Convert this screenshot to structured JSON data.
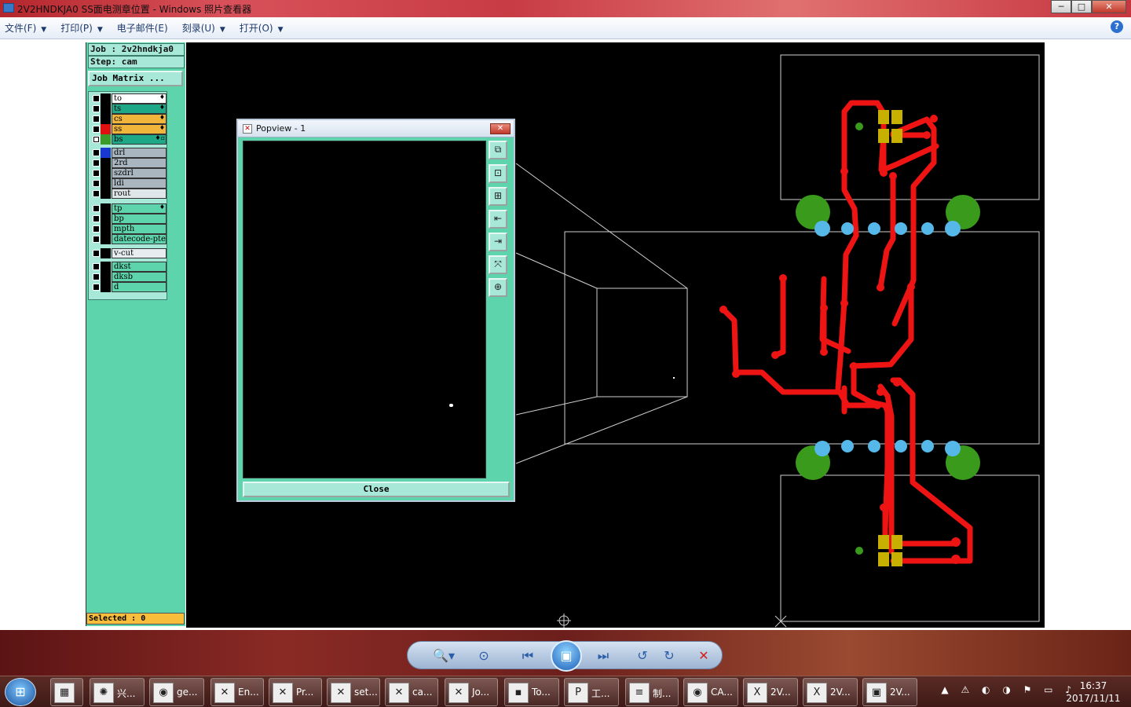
{
  "window": {
    "title": "2V2HNDKJA0 SS面电测章位置 - Windows 照片查看器",
    "minimize": "─",
    "maximize": "□",
    "close": "✕"
  },
  "menu": [
    {
      "label": "文件(F)",
      "arrow": "▼"
    },
    {
      "label": "打印(P)",
      "arrow": "▼"
    },
    {
      "label": "电子邮件(E)",
      "arrow": ""
    },
    {
      "label": "刻录(U)",
      "arrow": "▼"
    },
    {
      "label": "打开(O)",
      "arrow": "▼"
    }
  ],
  "help": "?",
  "genesis": {
    "job": "Job : 2v2hndkja0",
    "step": "Step: cam",
    "matrix_button": "Job Matrix ...",
    "selected": "Selected : 0",
    "layers": [
      {
        "name": "to",
        "checked": false,
        "swatch": "#000000",
        "bg": "#ffffff",
        "mark": "♦"
      },
      {
        "name": "ts",
        "checked": false,
        "swatch": "#000000",
        "bg": "#1fa888",
        "mark": "♦"
      },
      {
        "name": "cs",
        "checked": false,
        "swatch": "#000000",
        "bg": "#f2b53b",
        "mark": "♦"
      },
      {
        "name": "ss",
        "checked": false,
        "swatch": "#e01010",
        "bg": "#f2b53b",
        "mark": "♦"
      },
      {
        "name": "bs",
        "checked": true,
        "swatch": "#3a9a2a",
        "bg": "#1fa888",
        "mark": "♦▫"
      },
      {
        "name": "drl",
        "checked": false,
        "swatch": "#1838d0",
        "bg": "#a9b6bf",
        "mark": ""
      },
      {
        "name": "2rd",
        "checked": false,
        "swatch": "#000000",
        "bg": "#a9b6bf",
        "mark": ""
      },
      {
        "name": "szdrl",
        "checked": false,
        "swatch": "#000000",
        "bg": "#a9b6bf",
        "mark": ""
      },
      {
        "name": "ldi",
        "checked": false,
        "swatch": "#000000",
        "bg": "#a9b6bf",
        "mark": ""
      },
      {
        "name": "rout",
        "checked": false,
        "swatch": "#000000",
        "bg": "#dfe6ea",
        "mark": ""
      },
      {
        "name": "tp",
        "checked": false,
        "swatch": "#000000",
        "bg": "#5ed4ad",
        "mark": "♦"
      },
      {
        "name": "bp",
        "checked": false,
        "swatch": "#000000",
        "bg": "#5ed4ad",
        "mark": ""
      },
      {
        "name": "mpth",
        "checked": false,
        "swatch": "#000000",
        "bg": "#5ed4ad",
        "mark": ""
      },
      {
        "name": "datecode-pte",
        "checked": false,
        "swatch": "#000000",
        "bg": "#5ed4ad",
        "mark": ""
      },
      {
        "name": "v-cut",
        "checked": false,
        "swatch": "#000000",
        "bg": "#e6ecef",
        "mark": ""
      },
      {
        "name": "dkst",
        "checked": false,
        "swatch": "#000000",
        "bg": "#5ed4ad",
        "mark": ""
      },
      {
        "name": "dksb",
        "checked": false,
        "swatch": "#000000",
        "bg": "#5ed4ad",
        "mark": ""
      },
      {
        "name": "d",
        "checked": false,
        "swatch": "#000000",
        "bg": "#5ed4ad",
        "mark": ""
      }
    ]
  },
  "popup": {
    "title": "Popview - 1",
    "close_x": "✕",
    "close_button": "Close",
    "tools": [
      "⧉",
      "⊡",
      "⊞",
      "⇤",
      "⇥",
      "⤧",
      "⊕"
    ]
  },
  "player": {
    "zoom": "🔍▾",
    "fit": "⊙",
    "prev": "⏮",
    "slideshow": "▣",
    "next": "⏭",
    "rotate_ccw": "↺",
    "rotate_cw": "↻",
    "delete": "✕"
  },
  "taskbar": {
    "start": "⊞",
    "buttons": [
      {
        "icon": "▦",
        "label": ""
      },
      {
        "icon": "✺",
        "label": "兴..."
      },
      {
        "icon": "◉",
        "label": "ge..."
      },
      {
        "icon": "✕",
        "label": "En..."
      },
      {
        "icon": "✕",
        "label": "Pr..."
      },
      {
        "icon": "✕",
        "label": "set..."
      },
      {
        "icon": "✕",
        "label": "ca..."
      },
      {
        "icon": "✕",
        "label": "Jo..."
      },
      {
        "icon": "▪",
        "label": "To..."
      },
      {
        "icon": "P",
        "label": "工..."
      },
      {
        "icon": "≡",
        "label": "制..."
      },
      {
        "icon": "◉",
        "label": "CA..."
      },
      {
        "icon": "X",
        "label": "2V..."
      },
      {
        "icon": "X",
        "label": "2V..."
      },
      {
        "icon": "▣",
        "label": "2V..."
      }
    ],
    "tray": "▲ ⚠ ◐ ◑ ⚑ ▭ ♪",
    "time": "16:37",
    "date": "2017/11/11"
  },
  "colors": {
    "panel": "#5ed4ad",
    "trace": "#ee1414",
    "pad_green": "#3a9a1c",
    "pad_blue": "#55b8e8",
    "smd": "#c8b000",
    "outline": "#cfcfcf"
  }
}
